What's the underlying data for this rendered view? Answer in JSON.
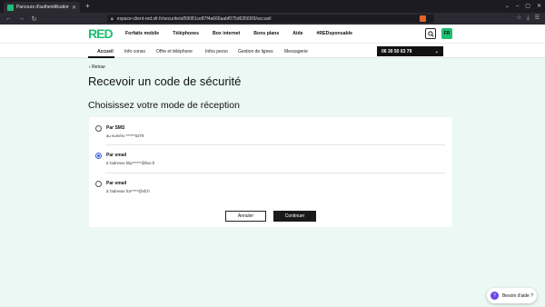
{
  "browser": {
    "tab_title": "Parcours d'authentification",
    "new_tab_label": "+",
    "url": "espace-client-red.sfr.fr/securite/af59081ce87f4a666aabf075d63565f3/accueil",
    "window_controls": [
      "⌄",
      "–",
      "▢",
      "✕"
    ],
    "toolbar_icons": [
      "☆",
      "⤓",
      "☰"
    ]
  },
  "site": {
    "logo": "RED",
    "main_nav": [
      "Forfaits mobile",
      "Téléphones",
      "Box internet",
      "Bons plans",
      "Aide",
      "#REDsponsable"
    ],
    "lang": "FR",
    "sub_nav": [
      "Accueil",
      "Info conso",
      "Offre et téléphone",
      "Infos perso",
      "Gestion de lignes",
      "Messagerie"
    ],
    "active_sub_nav": "Accueil",
    "line_number": "06 30 50 63 79",
    "accent_color": "#1dbf73"
  },
  "page": {
    "back": "Retour",
    "title": "Recevoir un code de sécurité",
    "subtitle": "Choisissez votre mode de réception",
    "options": [
      {
        "title": "Par SMS",
        "detail": "au numéro ******6379",
        "selected": false
      },
      {
        "title": "Par email",
        "detail": "à l'adresse btip******@live.fr",
        "selected": true
      },
      {
        "title": "Par email",
        "detail": "à l'adresse fra*****@sfr.fr",
        "selected": false
      }
    ],
    "cancel_label": "Annuler",
    "continue_label": "Continuer"
  },
  "help": {
    "label": "Besoin d'aide ?"
  }
}
